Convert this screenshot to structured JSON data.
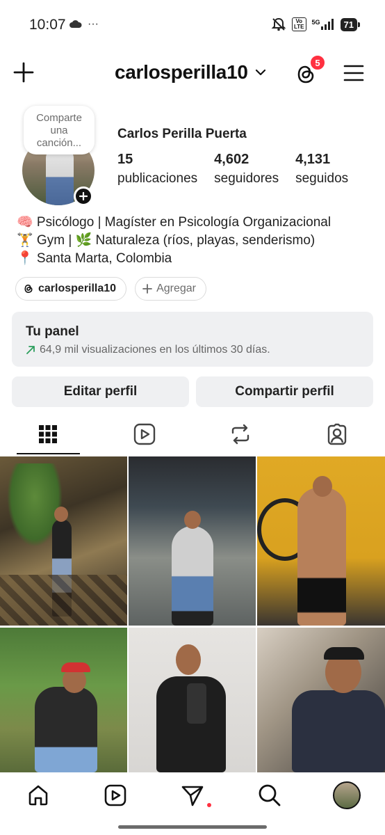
{
  "status_bar": {
    "time": "10:07",
    "extra": "···",
    "lte_top": "Vo",
    "lte_bottom": "LTE",
    "network": "5G",
    "battery": "71"
  },
  "header": {
    "username": "carlosperilla10",
    "notification_count": "5"
  },
  "profile": {
    "note": "Comparte una canción...",
    "full_name": "Carlos Perilla Puerta",
    "stats": [
      {
        "value": "15",
        "label": "publicaciones"
      },
      {
        "value": "4,602",
        "label": "seguidores"
      },
      {
        "value": "4,131",
        "label": "seguidos"
      }
    ],
    "bio": [
      "🧠 Psicólogo | Magíster en Psicología Organizacional",
      "🏋️ Gym | 🌿 Naturaleza (ríos, playas, senderismo)",
      "📍 Santa Marta, Colombia"
    ]
  },
  "chips": {
    "threads_label": "carlosperilla10",
    "add_label": "Agregar"
  },
  "panel": {
    "title": "Tu panel",
    "subtitle": "64,9 mil visualizaciones en los últimos 30 días."
  },
  "buttons": {
    "edit": "Editar perfil",
    "share": "Compartir perfil"
  },
  "tabs": [
    "grid-icon",
    "reels-icon",
    "reposts-icon",
    "tagged-icon"
  ],
  "bottom_nav": [
    "home-icon",
    "reels-icon",
    "send-icon",
    "search-icon",
    "profile-avatar"
  ],
  "colors": {
    "badge": "#ff3040",
    "button_bg": "#eff0f2",
    "text": "#222222"
  }
}
